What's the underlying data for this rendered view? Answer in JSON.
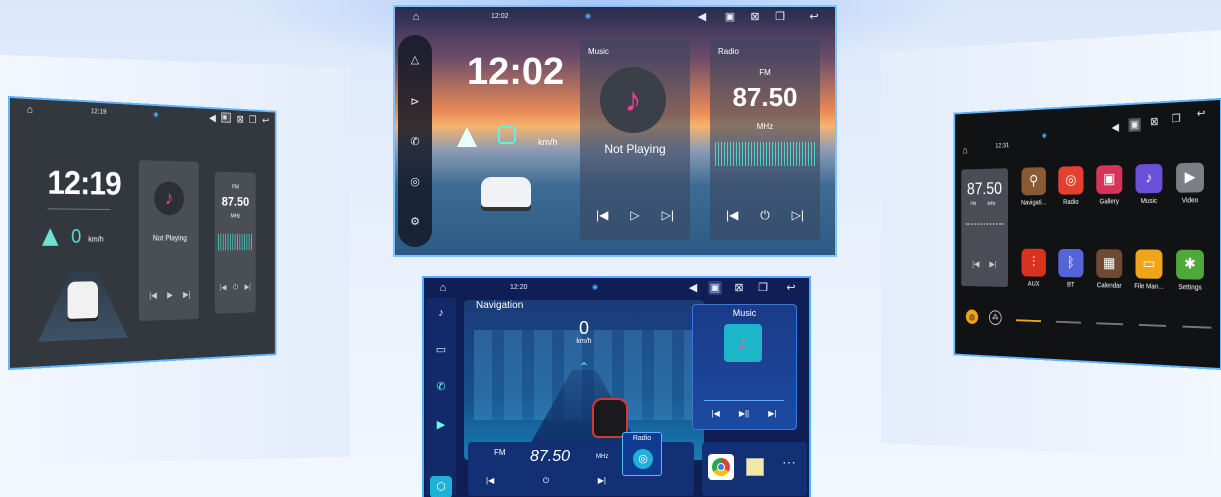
{
  "left": {
    "time": "12:19",
    "status_time": "12:19",
    "speed": "0",
    "speed_unit": "km/h",
    "music_status": "Not Playing",
    "radio_band": "FM",
    "radio_freq": "87.50",
    "radio_unit": "MHz"
  },
  "center": {
    "status_time": "12:02",
    "time": "12:02",
    "speed_unit": "km/h",
    "music_title": "Music",
    "music_status": "Not Playing",
    "radio_title": "Radio",
    "radio_band": "FM",
    "radio_freq": "87.50",
    "radio_unit": "MHz"
  },
  "right": {
    "status_time": "12:31",
    "radio_freq": "87.50",
    "radio_band": "FM",
    "radio_unit": "MHz",
    "apps": [
      {
        "label": "Navigati...",
        "color": "#8a5a34",
        "icon": "map-pin-icon"
      },
      {
        "label": "Radio",
        "color": "#e4402f",
        "icon": "radio-icon"
      },
      {
        "label": "Gallery",
        "color": "#d8335a",
        "icon": "gallery-icon"
      },
      {
        "label": "Music",
        "color": "#6a4fd8",
        "icon": "music-icon"
      },
      {
        "label": "Video",
        "color": "#7d7f86",
        "icon": "play-icon"
      },
      {
        "label": "AUX",
        "color": "#d8331f",
        "icon": "aux-icon"
      },
      {
        "label": "BT",
        "color": "#5565d8",
        "icon": "bluetooth-icon"
      },
      {
        "label": "Calendar",
        "color": "#6e4a32",
        "icon": "calendar-icon"
      },
      {
        "label": "File Man...",
        "color": "#f0a418",
        "icon": "folder-icon"
      },
      {
        "label": "Settings",
        "color": "#4fa83a",
        "icon": "gear-icon"
      }
    ]
  },
  "bottom": {
    "status_time": "12:20",
    "nav_title": "Navigation",
    "speed": "0",
    "speed_unit": "km/h",
    "music_title": "Music",
    "radio_band": "FM",
    "radio_freq": "87.50",
    "radio_unit": "MHz",
    "radio_title": "Radio"
  }
}
